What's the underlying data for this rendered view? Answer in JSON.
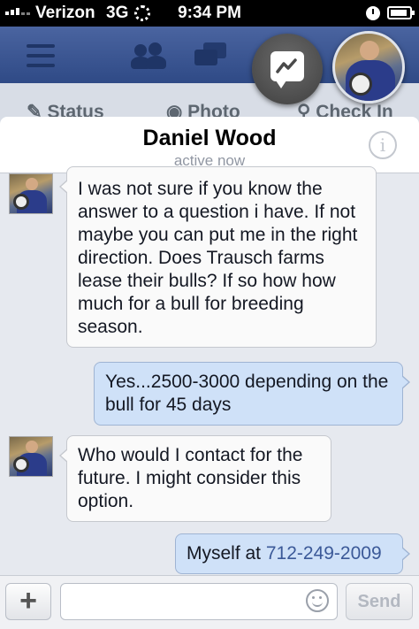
{
  "status_bar": {
    "carrier": "Verizon",
    "network": "3G",
    "time": "9:34 PM"
  },
  "fb_header": {
    "icons": [
      "menu-icon",
      "friends-icon",
      "messages-icon"
    ]
  },
  "composer": {
    "status": "Status",
    "photo": "Photo",
    "check_in": "Check In"
  },
  "chat": {
    "contact_name": "Daniel Wood",
    "presence": "active now",
    "messages": [
      {
        "from": "them",
        "text": "I was not sure if you know the answer to a question i have. If not maybe you can put me in the right direction.  Does Trausch farms lease their bulls?  If so how how much for a bull for breeding season."
      },
      {
        "from": "me",
        "text": "Yes...2500-3000 depending on the bull for 45 days"
      },
      {
        "from": "them",
        "text": "Who would I contact for the future. I might consider this option."
      },
      {
        "from": "me",
        "text": "Myself at ",
        "phone": "712-249-2009"
      }
    ]
  },
  "compose_bar": {
    "plus_label": "+",
    "input_value": "",
    "send_label": "Send"
  },
  "colors": {
    "fb_blue": "#3a5795",
    "outgoing_bubble": "#cfe1f8",
    "link": "#3b5998"
  }
}
